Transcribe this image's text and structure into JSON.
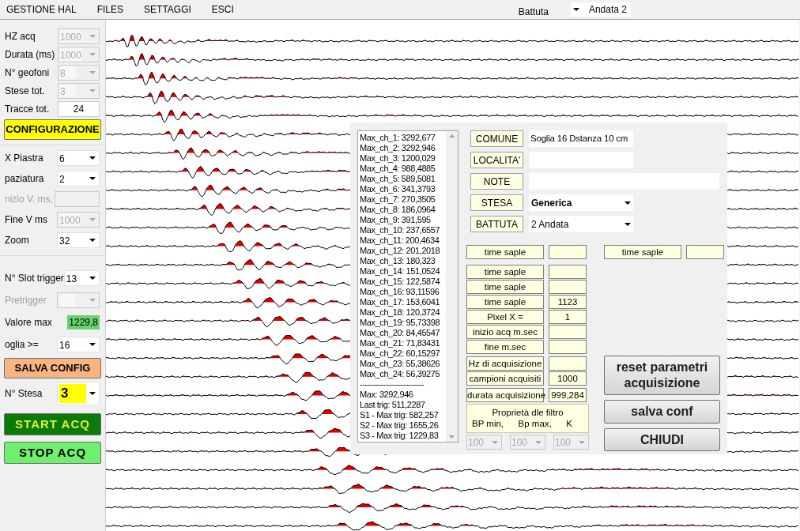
{
  "menu": [
    "GESTIONE HAL",
    "FILES",
    "SETTAGGI",
    "ESCI"
  ],
  "toolbar": {
    "label": "Battuta",
    "value": "Andata 2"
  },
  "left_panel": {
    "sections": [
      [
        {
          "kind": "combo",
          "label": "HZ acq",
          "value": "1000",
          "disabled": true,
          "highlighted": false
        },
        {
          "kind": "combo",
          "label": "Durata (ms)",
          "value": "1000",
          "disabled": true,
          "highlighted": false
        },
        {
          "kind": "combo",
          "label": "N° geofoni",
          "value": "8",
          "disabled": true,
          "highlighted": false
        },
        {
          "kind": "combo",
          "label": "Stese tot.",
          "value": "3",
          "disabled": true,
          "highlighted": false
        },
        {
          "kind": "field",
          "label": "Tracce tot.",
          "value": "24",
          "disabled": false
        },
        {
          "kind": "button",
          "label": "CONFIGURAZIONE",
          "color": "#ffff00"
        }
      ],
      [
        {
          "kind": "combo",
          "label": "X Piastra",
          "value": "6",
          "disabled": false,
          "highlighted": false
        },
        {
          "kind": "combo",
          "label": "paziatura",
          "value": "2",
          "disabled": false,
          "highlighted": false
        },
        {
          "kind": "field",
          "label": "nizio V. ms,",
          "disabled": true
        },
        {
          "kind": "combo",
          "label": "Fine V ms",
          "value": "1000",
          "disabled": true,
          "highlighted": false
        },
        {
          "kind": "combo",
          "label": "Zoom",
          "value": "32",
          "disabled": false,
          "highlighted": false
        }
      ],
      [
        {
          "kind": "combo",
          "label": "N° Slot trigger",
          "value": "13",
          "disabled": false,
          "highlighted": false
        },
        {
          "kind": "combo",
          "label": "Pretrigger",
          "disabled": true,
          "highlighted": false
        },
        {
          "kind": "readout",
          "label": "Valore max",
          "value": "1229,8",
          "color": "#66d36e"
        },
        {
          "kind": "combo",
          "label": "oglia >=",
          "value": "16",
          "disabled": false,
          "highlighted": false
        },
        {
          "kind": "button",
          "label": "SALVA CONFIG",
          "color": "#f8b482"
        },
        {
          "kind": "combo",
          "label": "N° Stesa",
          "value": "3",
          "disabled": false,
          "highlighted": true
        },
        {
          "kind": "button",
          "label": "START ACQ",
          "color": "#0b7a0b"
        },
        {
          "kind": "button",
          "label": "STOP ACQ",
          "color": "#6ef06e"
        }
      ]
    ]
  },
  "stats_list": {
    "lines": [
      "Max_ch_1: 3292,677",
      "Max_ch_2: 3292,946",
      "Max_ch_3: 1200,029",
      "Max_ch_4: 988,4885",
      "Max_ch_5: 589,5081",
      "Max_ch_6: 341,3793",
      "Max_ch_7: 270,3505",
      "Max_ch_8: 186,0964",
      "Max_ch_9: 391,595",
      "Max_ch_10: 237,6557",
      "Max_ch_11: 200,4634",
      "Max_ch_12: 201,2018",
      "Max_ch_13: 180,323",
      "Max_ch_14: 151,0524",
      "Max_ch_15: 122,5874",
      "Max_ch_16: 93,11596",
      "Max_ch_17: 153,6041",
      "Max_ch_18: 120,3724",
      "Max_ch_19: 95,73398",
      "Max_ch_20: 84,45547",
      "Max_ch_21: 71,83431",
      "Max_ch_22: 60,15297",
      "Max_ch_23: 55,38626",
      "Max_ch_24: 56,39275",
      "-------------------------",
      "Max: 3292,946",
      "Last trig: 511,2287",
      "S1 - Max trig: 582,257",
      "S2 - Max trig: 1655,26",
      "S3 - Max trig: 1229,83"
    ]
  },
  "info_form": {
    "fields": [
      {
        "label": "COMUNE",
        "kind": "text",
        "value": "Soglia 16 Dstanza 10 cm",
        "wide": false
      },
      {
        "label": "LOCALITA'",
        "kind": "text",
        "wide": false
      },
      {
        "label": "NOTE",
        "kind": "text",
        "wide": true
      },
      {
        "label": "STESA",
        "kind": "combo",
        "value": "Generica",
        "bold": true,
        "wide": false
      },
      {
        "label": "BATTUTA",
        "kind": "combo",
        "value": "2 Andata",
        "bold": false,
        "wide": false
      }
    ]
  },
  "params": {
    "rows": [
      {
        "label": "time saple"
      },
      {
        "label": "time saple"
      },
      {
        "label": "time saple"
      },
      {
        "label": "time saple",
        "value": "1123"
      },
      {
        "label": "Pixel X =",
        "value": "1"
      },
      {
        "label": "inizio acq m.sec"
      },
      {
        "label": "fine m.sec"
      },
      {
        "label": "Hz di acquisizione"
      },
      {
        "label": "campioni acquisiti",
        "value": "1000"
      },
      {
        "label": "durata acquisizione",
        "value": "999,284"
      }
    ],
    "side": {
      "label": "time saple"
    }
  },
  "filter": {
    "title": "Proprietà dle filtro",
    "columns": [
      "BP min,",
      "Bp max,",
      "K"
    ],
    "combos": [
      {
        "value": "100",
        "disabled": true
      },
      {
        "value": "100",
        "disabled": true
      },
      {
        "value": "100",
        "disabled": true
      }
    ]
  },
  "buttons": [
    "reset parametri acquisizione",
    "salva conf",
    "CHIUDI"
  ]
}
